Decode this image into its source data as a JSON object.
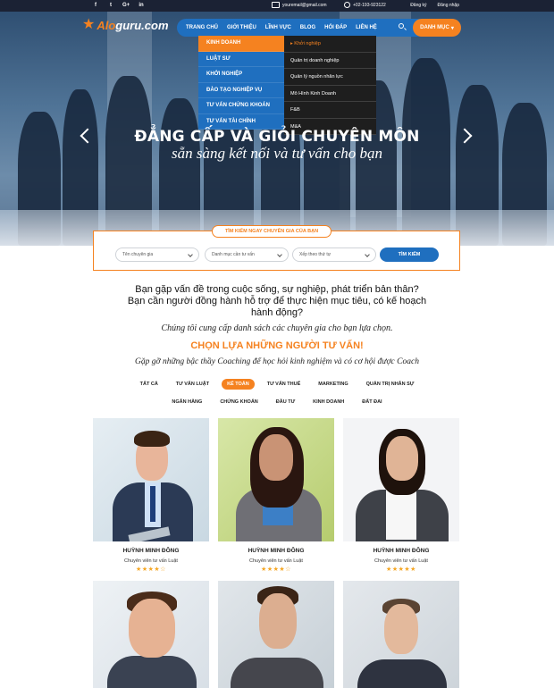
{
  "topbar": {
    "social": [
      "f",
      "t",
      "G+",
      "in"
    ],
    "email": "youremail@gmail.com",
    "phone": "+02-193-923122",
    "register": "Đăng ký",
    "login": "Đăng nhập"
  },
  "brand": {
    "logo_prefix": "Alo",
    "logo_suffix": "guru.com"
  },
  "nav": {
    "items": [
      "TRANG CHỦ",
      "GIỚI THIỆU",
      "LĨNH VỰC",
      "BLOG",
      "HỎI ĐÁP",
      "LIÊN HỆ"
    ],
    "category_button": "DANH MỤC"
  },
  "dropdown_primary": [
    "KINH DOANH",
    "LUẬT SƯ",
    "KHỞI NGHIỆP",
    "ĐÀO TẠO NGHIỆP VỤ",
    "TƯ VẤN CHỨNG KHOÁN",
    "TƯ VẤN TÀI CHÍNH"
  ],
  "dropdown_secondary": [
    "Khởi nghiệp",
    "Quản trị doanh nghiệp",
    "Quản lý nguồn nhân lực",
    "Mô Hình Kinh Doanh",
    "F&B",
    "M&A"
  ],
  "hero": {
    "title": "ĐẲNG CẤP VÀ GIỎI CHUYÊN MÔN",
    "subtitle": "sẵn sàng kết nối và tư vấn cho bạn"
  },
  "search": {
    "label": "TÌM KIẾM NGAY CHUYÊN GIA CỦA BẠN",
    "expert_name": "Tên chuyên gia",
    "category": "Danh mục cần tư vấn",
    "sort": "Xếp theo thứ tự",
    "button": "TÌM KIẾM"
  },
  "intro": {
    "question": "Bạn gặp vấn đề trong cuộc sống, sự nghiệp, phát triển bản thân? Bạn cần người đồng hành hỗ trợ để thực hiện mục tiêu, có kế hoạch hành động?",
    "offer": "Chúng tôi cung cấp danh sách các chuyên gia cho bạn lựa chọn."
  },
  "section": {
    "title": "CHỌN LỰA NHỮNG NGƯỜI TƯ VẤN!",
    "subtitle": "Gặp gỡ những bậc thầy Coaching để học hỏi kinh nghiệm và có cơ hội được Coach"
  },
  "filters_row1": [
    "TẤT CẢ",
    "TƯ VẤN LUẬT",
    "KẾ TOÁN",
    "TƯ VẤN THUẾ",
    "MARKETING",
    "QUẢN TRỊ NHÂN SỰ"
  ],
  "filters_row2": [
    "NGÂN HÀNG",
    "CHỨNG KHOÁN",
    "ĐẦU TƯ",
    "KINH DOANH",
    "ĐẤT ĐAI"
  ],
  "active_filter": "KẾ TOÁN",
  "experts": [
    {
      "name": "HUỲNH MINH ĐÔNG",
      "role": "Chuyên viên tư vấn Luật",
      "rating": "★★★★☆"
    },
    {
      "name": "HUỲNH MINH ĐÔNG",
      "role": "Chuyên viên tư vấn Luật",
      "rating": "★★★★☆"
    },
    {
      "name": "HUỲNH MINH ĐÔNG",
      "role": "Chuyên viên tư vấn Luật",
      "rating": "★★★★★"
    }
  ],
  "colors": {
    "accent": "#f58220",
    "primary": "#1f6fbf",
    "topbar": "#1b2234",
    "dropdown_dark": "#1e1e1e"
  }
}
